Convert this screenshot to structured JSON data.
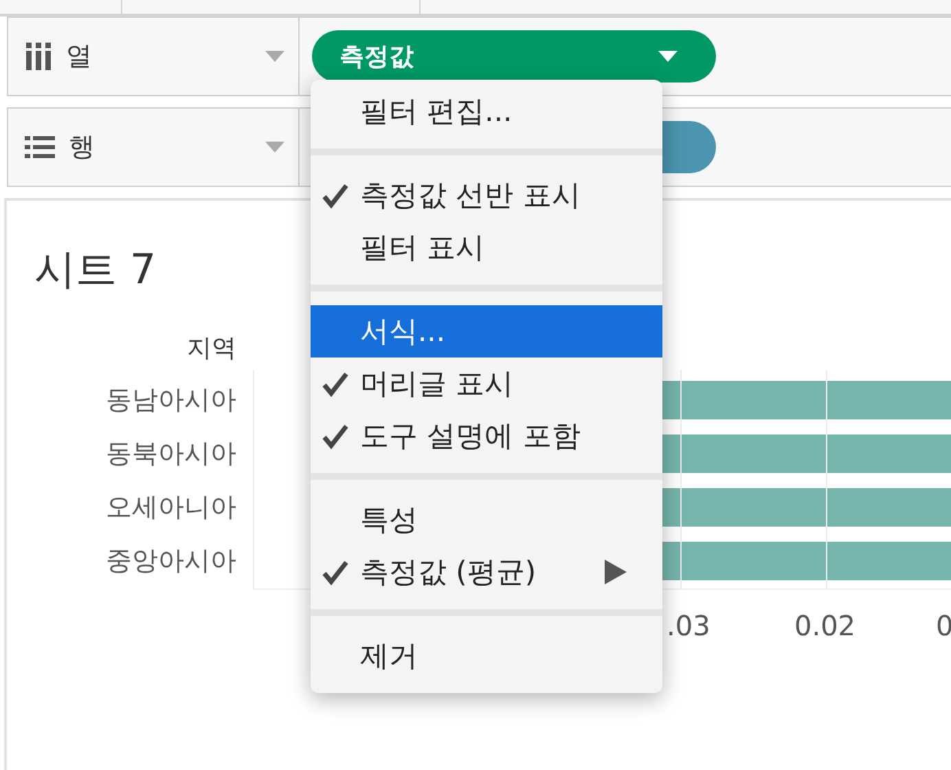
{
  "shelves": [
    {
      "kind": "columns",
      "label": "열",
      "pill": {
        "label": "측정값",
        "color": "#009966"
      }
    },
    {
      "kind": "rows",
      "label": "행",
      "pill": {
        "color": "#4b95b0"
      }
    }
  ],
  "sheet": {
    "title": "시트 7",
    "row_header": "지역",
    "rows": [
      "동남아시아",
      "동북아시아",
      "오세아니아",
      "중앙아시아"
    ],
    "axis_ticks": [
      ".03",
      "0.02",
      "0"
    ]
  },
  "menu": [
    {
      "kind": "item",
      "label": "필터 편집...",
      "checked": false,
      "selected": false,
      "submenu": false
    },
    {
      "kind": "separator"
    },
    {
      "kind": "item",
      "label": "측정값 선반 표시",
      "checked": true,
      "selected": false,
      "submenu": false
    },
    {
      "kind": "item",
      "label": "필터 표시",
      "checked": false,
      "selected": false,
      "submenu": false
    },
    {
      "kind": "separator"
    },
    {
      "kind": "item",
      "label": "서식...",
      "checked": false,
      "selected": true,
      "submenu": false
    },
    {
      "kind": "item",
      "label": "머리글 표시",
      "checked": true,
      "selected": false,
      "submenu": false
    },
    {
      "kind": "item",
      "label": "도구 설명에 포함",
      "checked": true,
      "selected": false,
      "submenu": false
    },
    {
      "kind": "separator"
    },
    {
      "kind": "item",
      "label": "특성",
      "checked": false,
      "selected": false,
      "submenu": false
    },
    {
      "kind": "item",
      "label": "측정값 (평균)",
      "checked": true,
      "selected": false,
      "submenu": true
    },
    {
      "kind": "separator"
    },
    {
      "kind": "item",
      "label": "제거",
      "checked": false,
      "selected": false,
      "submenu": false
    }
  ]
}
